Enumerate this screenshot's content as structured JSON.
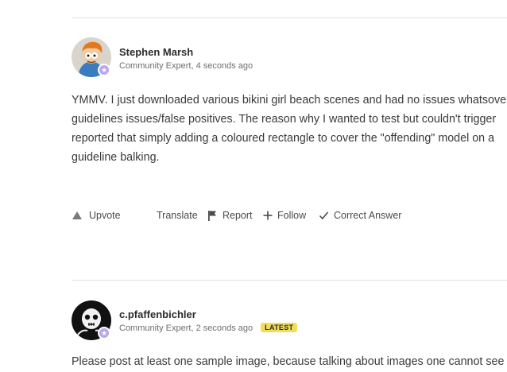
{
  "posts": [
    {
      "author": "Stephen Marsh",
      "role": "Community Expert",
      "time": "4 seconds ago",
      "body_lines": [
        "YMMV. I just downloaded various bikini girl beach scenes and had no issues whatsover",
        "guidelines issues/false positives. The reason why I wanted to test but couldn't trigger",
        "reported that simply adding a coloured rectangle to cover the \"offending\" model on a",
        "guideline balking."
      ],
      "actions": {
        "upvote": "Upvote",
        "translate": "Translate",
        "report": "Report",
        "follow": "Follow",
        "correct": "Correct Answer"
      }
    },
    {
      "author": "c.pfaffenbichler",
      "role": "Community Expert",
      "time": "2 seconds ago",
      "badge": "LATEST",
      "body_lines": [
        "Please post at least one sample image, because talking about images one cannot see"
      ]
    }
  ],
  "colors": {
    "expert_badge": "#b8a6f0",
    "latest_badge": "#f0de5b",
    "divider": "#e1e1e1"
  }
}
